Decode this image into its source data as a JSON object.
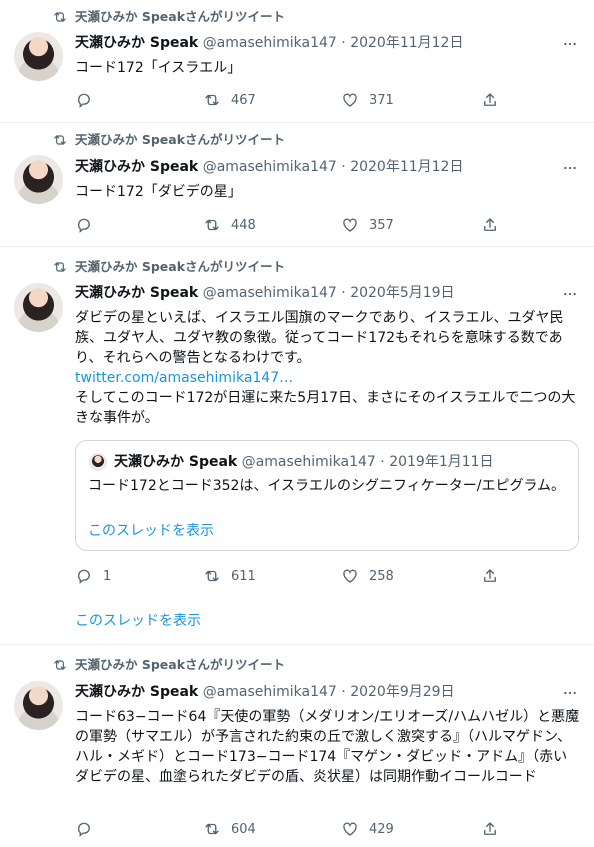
{
  "retweet_label": "天瀬ひみか Speakさんがリツイート",
  "tweets": [
    {
      "name": "天瀬ひみか Speak",
      "handle": "@amasehimika147",
      "date": "2020年11月12日",
      "text": "コード172「イスラエル」",
      "retweets": "467",
      "likes": "371",
      "replies": ""
    },
    {
      "name": "天瀬ひみか Speak",
      "handle": "@amasehimika147",
      "date": "2020年11月12日",
      "text": "コード172「ダビデの星」",
      "retweets": "448",
      "likes": "357",
      "replies": ""
    },
    {
      "name": "天瀬ひみか Speak",
      "handle": "@amasehimika147",
      "date": "2020年5月19日",
      "text_1": "ダビデの星といえば、イスラエル国旗のマークであり、イスラエル、ユダヤ民族、ユダヤ人、ユダヤ教の象徴。従ってコード172もそれらを意味する数であり、それらへの警告となるわけです。",
      "link": "twitter.com/amasehimika147…",
      "text_2": "そしてこのコード172が日運に来た5月17日、まさにそのイスラエルで二つの大きな事件が。",
      "quote": {
        "name": "天瀬ひみか Speak",
        "handle": "@amasehimika147",
        "date": "2019年1月11日",
        "text": "コード172とコード352は、イスラエルのシグニフィケーター/エピグラム。",
        "thread_link": "このスレッドを表示"
      },
      "replies": "1",
      "retweets": "611",
      "likes": "258",
      "thread_link": "このスレッドを表示"
    },
    {
      "name": "天瀬ひみか Speak",
      "handle": "@amasehimika147",
      "date": "2020年9月29日",
      "text": "コード63−コード64『天使の軍勢（メダリオン/エリオーズ/ハムハゼル）と悪魔の軍勢（サマエル）が予言された約束の丘で激しく激突する』（ハルマゲドン、ハル・メギド）とコード173−コード174『マゲン・ダビッド・アドム』（赤いダビデの星、血塗られたダビデの盾、炎状星）は同期作動イコールコード",
      "retweets": "604",
      "likes": "429",
      "replies": ""
    }
  ],
  "colors": {
    "accent": "#1b95e0",
    "muted": "#536471",
    "border": "#ebeef0"
  },
  "icons": [
    "retweet-icon",
    "reply-icon",
    "like-icon",
    "share-icon",
    "more-icon"
  ]
}
